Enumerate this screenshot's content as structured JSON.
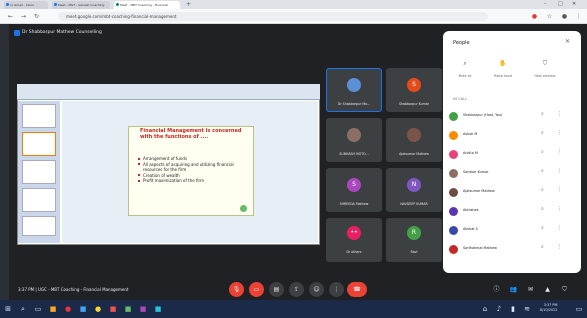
{
  "browser": {
    "tabs": [
      {
        "label": "1) Gmail - Inbox"
      },
      {
        "label": "Meet - MGT - Ganesh Coaching"
      },
      {
        "label": "Meet - MBT Coaching - Financial"
      }
    ],
    "url": "meet.google.com/mbt-coaching-financial-management"
  },
  "meet": {
    "title": "Dr Shabbarpur Mathew Counselling",
    "colors": {
      "background": "#202124",
      "end_call": "#ea4335",
      "tile": "#3c4043"
    }
  },
  "presentation": {
    "slide_title": "Financial Management is concerned with the functions of ....",
    "bullets": [
      "Arrangement of funds",
      "All aspects of acquiring and utilizing financial resources for the firm",
      "Creation of wealth",
      "Profit maximization of the firm"
    ]
  },
  "tiles": [
    {
      "name": "Dr Shabbarpur Ma...",
      "initial": "",
      "color": "#5b8fd6"
    },
    {
      "name": "Shabbarpur Kumar",
      "initial": "S",
      "color": "#e64a19"
    },
    {
      "name": "SUBHASH MOTO...",
      "initial": "",
      "color": "#8d6e63"
    },
    {
      "name": "Ajatsumar Mathew",
      "initial": "",
      "color": "#795548"
    },
    {
      "name": "SHREEDA Mathew",
      "initial": "S",
      "color": "#ab47bc"
    },
    {
      "name": "NAVDEEP KUMAR",
      "initial": "N",
      "color": "#7e57c2"
    },
    {
      "name": "Dr others",
      "initial": "••",
      "color": "#e91e63"
    },
    {
      "name": "Ravi",
      "initial": "R",
      "color": "#43a047"
    }
  ],
  "people": {
    "title": "People",
    "actions": [
      {
        "label": "Mute all",
        "icon": "mute-icon"
      },
      {
        "label": "Raise hand",
        "icon": "hand-icon"
      },
      {
        "label": "Host controls",
        "icon": "shield-icon"
      }
    ],
    "section": "IN CALL",
    "list": [
      {
        "name": "Shabbarpur (Host, You)",
        "color": "#43a047"
      },
      {
        "name": "Ashok M",
        "color": "#fb8c00"
      },
      {
        "name": "Ankita M",
        "color": "#ec407a"
      },
      {
        "name": "Sanskar Kumar",
        "color": "#8d6e63"
      },
      {
        "name": "Ajatsumar Mathew",
        "color": "#6d4c41"
      },
      {
        "name": "Abhishek",
        "color": "#5e35b1"
      },
      {
        "name": "Akshat S",
        "color": "#3949ab"
      },
      {
        "name": "Sarthakmal Mathew",
        "color": "#c62828"
      }
    ]
  },
  "footer": {
    "time": "3:37 PM",
    "meeting": "UGC - MBT Coaching - Financial Management"
  },
  "taskbar": {
    "time": "3:37 PM",
    "date": "8/10/2022"
  }
}
